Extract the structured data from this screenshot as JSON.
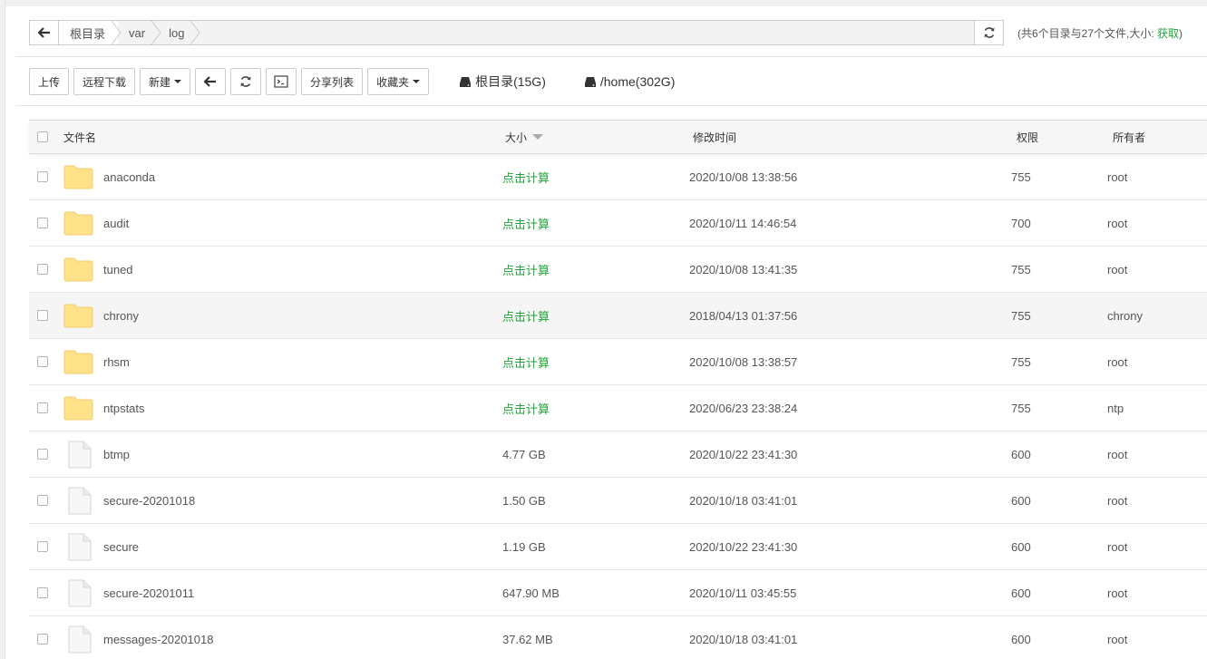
{
  "pathbar": {
    "crumbs": [
      "根目录",
      "var",
      "log"
    ]
  },
  "summary": {
    "text": "(共6个目录与27个文件,大小:",
    "fetch_label": "获取",
    "close": ")"
  },
  "toolbar": {
    "upload": "上传",
    "remote_download": "远程下载",
    "new": "新建",
    "share_list": "分享列表",
    "favorites": "收藏夹"
  },
  "disks": [
    {
      "label": "根目录(15G)"
    },
    {
      "label": "/home(302G)"
    }
  ],
  "table": {
    "headers": {
      "name": "文件名",
      "size": "大小",
      "mtime": "修改时间",
      "perm": "权限",
      "owner": "所有者"
    },
    "rows": [
      {
        "name": "anaconda",
        "type": "folder",
        "size": "点击计算",
        "mtime": "2020/10/08 13:38:56",
        "perm": "755",
        "owner": "root"
      },
      {
        "name": "audit",
        "type": "folder",
        "size": "点击计算",
        "mtime": "2020/10/11 14:46:54",
        "perm": "700",
        "owner": "root"
      },
      {
        "name": "tuned",
        "type": "folder",
        "size": "点击计算",
        "mtime": "2020/10/08 13:41:35",
        "perm": "755",
        "owner": "root"
      },
      {
        "name": "chrony",
        "type": "folder",
        "size": "点击计算",
        "mtime": "2018/04/13 01:37:56",
        "perm": "755",
        "owner": "chrony"
      },
      {
        "name": "rhsm",
        "type": "folder",
        "size": "点击计算",
        "mtime": "2020/10/08 13:38:57",
        "perm": "755",
        "owner": "root"
      },
      {
        "name": "ntpstats",
        "type": "folder",
        "size": "点击计算",
        "mtime": "2020/06/23 23:38:24",
        "perm": "755",
        "owner": "ntp"
      },
      {
        "name": "btmp",
        "type": "file",
        "size": "4.77 GB",
        "mtime": "2020/10/22 23:41:30",
        "perm": "600",
        "owner": "root"
      },
      {
        "name": "secure-20201018",
        "type": "file",
        "size": "1.50 GB",
        "mtime": "2020/10/18 03:41:01",
        "perm": "600",
        "owner": "root"
      },
      {
        "name": "secure",
        "type": "file",
        "size": "1.19 GB",
        "mtime": "2020/10/22 23:41:30",
        "perm": "600",
        "owner": "root"
      },
      {
        "name": "secure-20201011",
        "type": "file",
        "size": "647.90 MB",
        "mtime": "2020/10/11 03:45:55",
        "perm": "600",
        "owner": "root"
      },
      {
        "name": "messages-20201018",
        "type": "file",
        "size": "37.62 MB",
        "mtime": "2020/10/18 03:41:01",
        "perm": "600",
        "owner": "root"
      }
    ]
  },
  "colors": {
    "accent_green": "#20a53a",
    "folder_yellow": "#ffe28a",
    "border": "#cccccc"
  }
}
